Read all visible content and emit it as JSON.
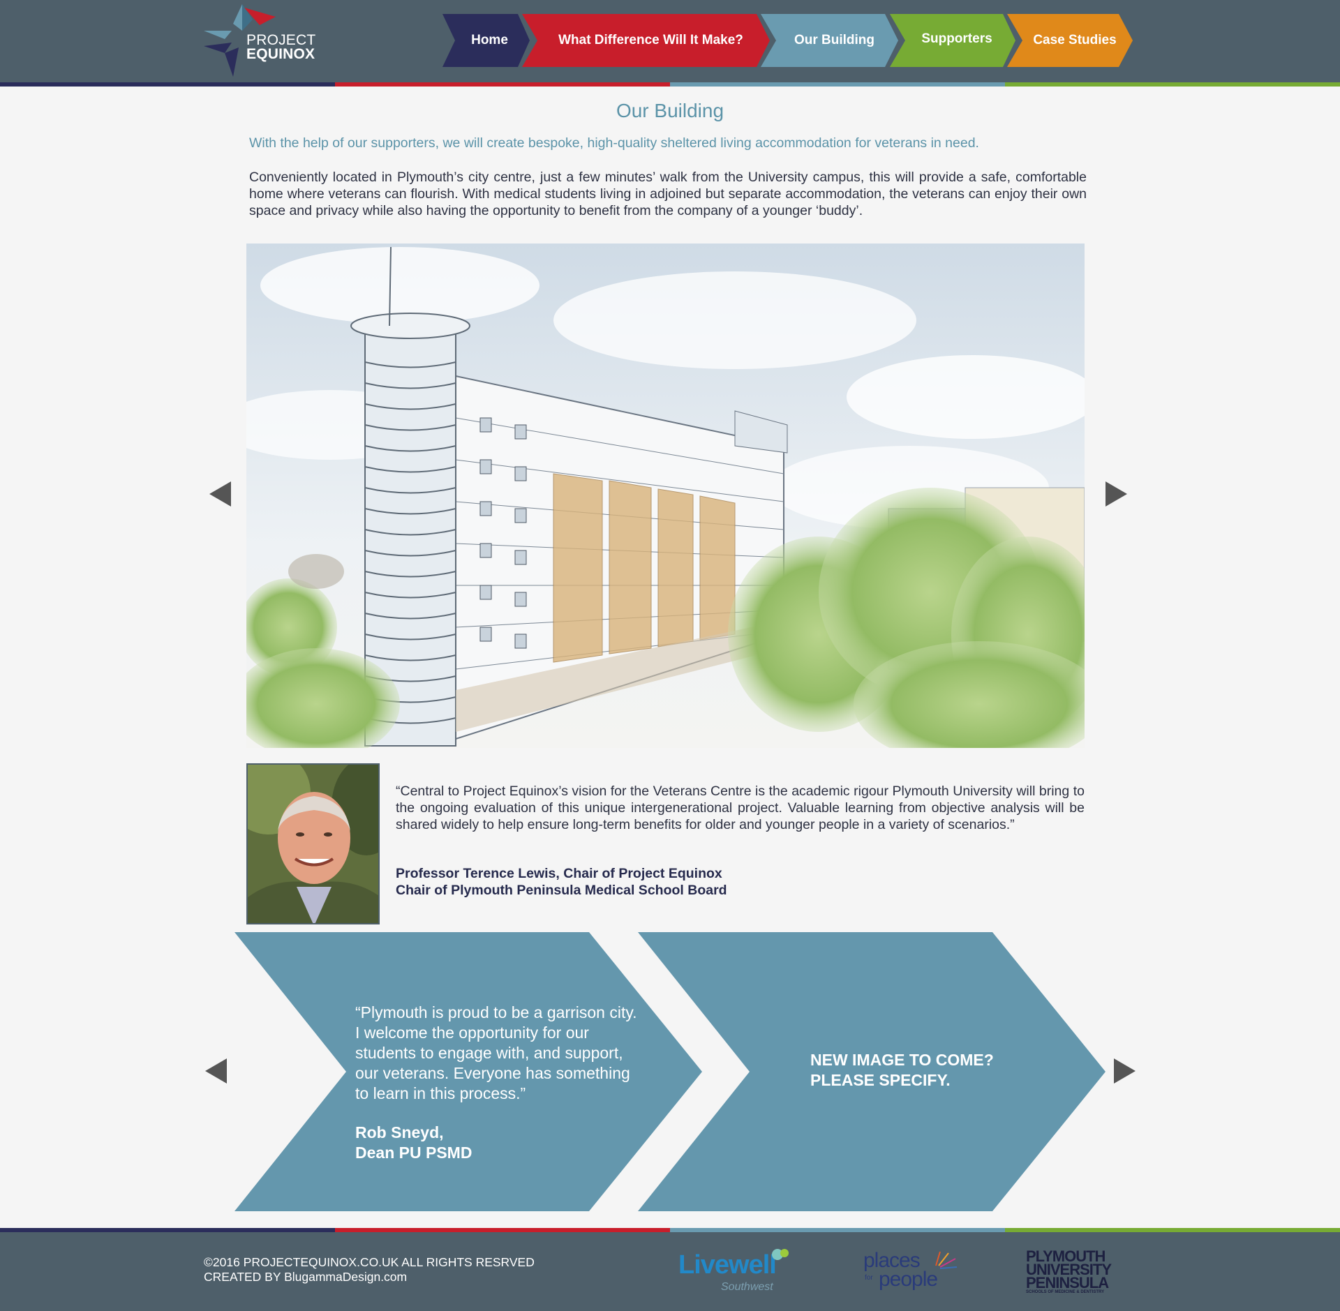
{
  "brand": {
    "logo_line1": "PROJECT",
    "logo_line2": "EQUINOX",
    "colors": {
      "navy": "#2b2d5b",
      "red": "#c81e2b",
      "blue": "#6a9bb0",
      "green": "#77ab34",
      "orange": "#e0891a",
      "header": "#4e5f6a"
    }
  },
  "nav": {
    "items": [
      {
        "label": "Home",
        "color": "#2b2d5b"
      },
      {
        "label": "What Difference Will It Make?",
        "color": "#c81e2b"
      },
      {
        "label": "Our Building",
        "color": "#6a9bb0"
      },
      {
        "label": "Supporters",
        "color": "#77ab34"
      },
      {
        "label": "Case Studies",
        "color": "#e0891a"
      }
    ]
  },
  "main": {
    "title": "Our Building",
    "lead": "With the help of our supporters, we will create bespoke, high-quality sheltered living accommodation for veterans in need.",
    "paragraph": "Conveniently located in Plymouth’s city centre, just a few minutes’ walk from the University campus, this will provide a safe, comfortable home where veterans can flourish. With medical students living in adjoined but separate accommodation, the veterans can enjoy their own space and privacy while also having the opportunity to benefit from the company of a younger ‘buddy’.",
    "building_image": "architectural sketch of building",
    "quote1": {
      "text": "“Central to Project Equinox’s vision for the Veterans Centre is the academic rigour Plymouth University will bring to the ongoing evaluation of this unique intergenerational project. Valuable learning from objective analysis will be shared widely to help ensure long-term benefits for older and younger people in a variety of scenarios.”",
      "name_line1": "Professor Terence Lewis, Chair of Project Equinox",
      "name_line2": "Chair of Plymouth Peninsula Medical School Board"
    },
    "quote2": {
      "text": "“Plymouth is proud to be a garrison city. I welcome the opportunity for our students to engage with, and support, our veterans. Everyone has something to learn in this process.”",
      "name_line1": "Rob Sneyd,",
      "name_line2": "Dean PU PSMD"
    },
    "placeholder": {
      "line1": "NEW IMAGE TO COME?",
      "line2": "PLEASE SPECIFY."
    }
  },
  "footer": {
    "copyright": "©2016 PROJECTEQUINOX.CO.UK ALL RIGHTS RESRVED",
    "credit": "CREATED BY BlugammaDesign.com",
    "sponsors": {
      "livewell_main": "Livewell",
      "livewell_sub": "Southwest",
      "places_line1": "places",
      "places_for": "for",
      "places_line2": "people",
      "pu_line1": "PLYMOUTH",
      "pu_line2": "UNIVERSITY",
      "pu_line3": "PENINSULA",
      "pu_line4": "SCHOOLS OF MEDICINE & DENTISTRY"
    }
  }
}
